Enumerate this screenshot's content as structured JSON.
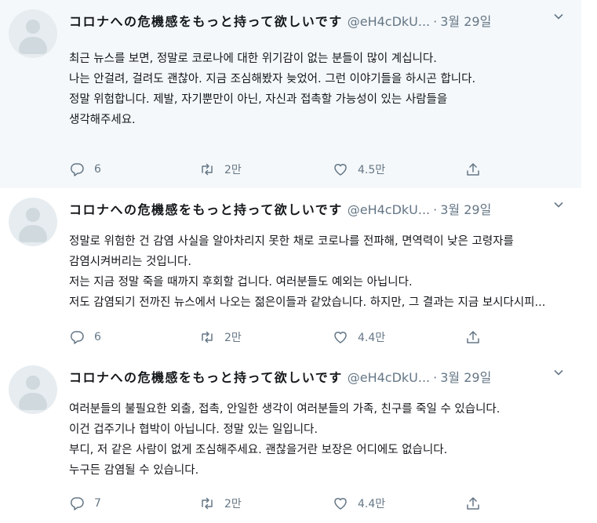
{
  "tweets": [
    {
      "name": "コロナへの危機感をもっと持って欲しいです",
      "handle": "@eH4cDkU...",
      "separator": "·",
      "time": "3월 29일",
      "lines": [
        "최근 뉴스를 보면, 정말로 코로나에 대한 위기감이 없는 분들이 많이 계십니다.",
        "나는 안걸려, 걸려도 괜찮아. 지금 조심해봤자 늦었어. 그런 이야기들을 하시곤 합니다.",
        "정말 위험합니다. 제발, 자기뿐만이 아닌, 자신과 접촉할 가능성이 있는 사람들을",
        "생각해주세요."
      ],
      "replies": "6",
      "retweets": "2만",
      "likes": "4.5만"
    },
    {
      "name": "コロナへの危機感をもっと持って欲しいです",
      "handle": "@eH4cDkU...",
      "separator": "·",
      "time": "3월 29일",
      "lines": [
        "정말로 위험한 건 감염 사실을 알아차리지 못한 채로 코로나를 전파해, 면역력이 낮은 고령자를",
        "감염시켜버리는 것입니다.",
        "저는 지금 정말 죽을 때까지 후회할 겁니다. 여러분들도 예외는 아닙니다.",
        "저도 감염되기 전까진 뉴스에서 나오는 젊은이들과 같았습니다. 하지만, 그 결과는 지금 보시다시피..."
      ],
      "replies": "6",
      "retweets": "2만",
      "likes": "4.4만"
    },
    {
      "name": "コロナへの危機感をもっと持って欲しいです",
      "handle": "@eH4cDkU...",
      "separator": "·",
      "time": "3월 29일",
      "lines": [
        "여러분들의 불필요한 외출, 접촉, 안일한 생각이 여러분들의 가족, 친구를 죽일 수 있습니다.",
        "이건 겁주기나 협박이 아닙니다. 정말 있는 일입니다.",
        "부디, 저 같은 사람이 없게 조심해주세요. 괜찮을거란 보장은 어디에도 없습니다.",
        "누구든 감염될 수 있습니다."
      ],
      "replies": "7",
      "retweets": "2만",
      "likes": "4.4만"
    }
  ],
  "icons": {
    "reply": "reply-icon",
    "retweet": "retweet-icon",
    "like": "like-icon",
    "share": "share-icon",
    "more": "chevron-down-icon"
  },
  "colors": {
    "highlight_background": "#f5f8fa",
    "secondary_text": "#657786",
    "thread_line": "#d9dfe3"
  }
}
